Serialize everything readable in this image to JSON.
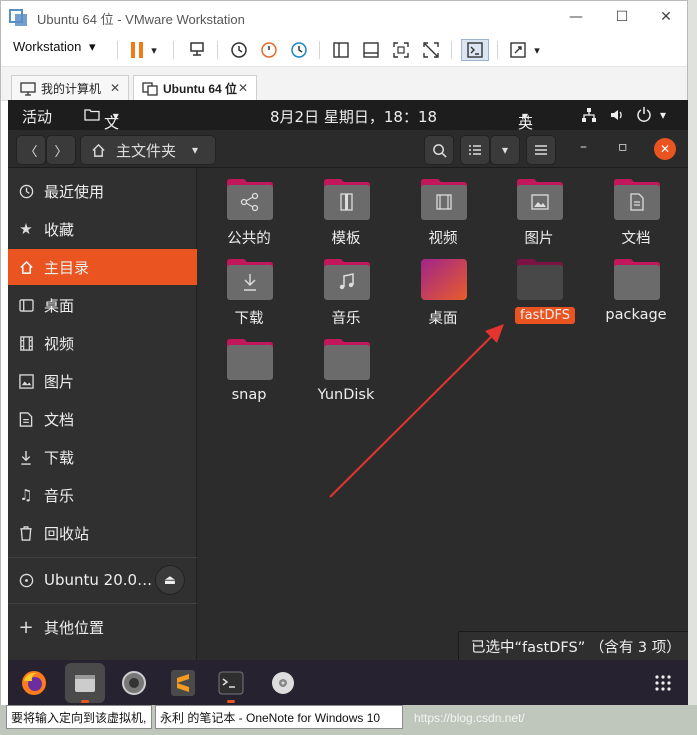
{
  "window": {
    "title": "Ubuntu 64 位 - VMware Workstation",
    "minimize": "—",
    "maximize": "☐",
    "close": "✕"
  },
  "toolbar": {
    "workstation_label": "Workstation",
    "dropdown_arrow": "▾"
  },
  "tabs": [
    {
      "label": "我的计算机",
      "close": "✕"
    },
    {
      "label": "Ubuntu 64 位",
      "close": "✕"
    }
  ],
  "ubuntu_topbar": {
    "activities": "活动",
    "app_menu": "文件",
    "app_menu_arrow": "▾",
    "clock": "8月2日 星期日，18：18",
    "input_method": "英",
    "input_arrow": "▾",
    "power_arrow": "▾"
  },
  "headerbar": {
    "back": "〈",
    "forward": "〉",
    "location": "主文件夹",
    "location_arrow": "▾",
    "view_arrow": "▾",
    "minimize": "–",
    "restore": "▫",
    "close": "✕"
  },
  "sidebar": {
    "items": [
      {
        "label": "最近使用",
        "icon": "clock-icon"
      },
      {
        "label": "收藏",
        "icon": "star-icon"
      },
      {
        "label": "主目录",
        "icon": "home-icon",
        "active": true
      },
      {
        "label": "桌面",
        "icon": "desktop-icon"
      },
      {
        "label": "视频",
        "icon": "video-icon"
      },
      {
        "label": "图片",
        "icon": "image-icon"
      },
      {
        "label": "文档",
        "icon": "document-icon"
      },
      {
        "label": "下载",
        "icon": "download-icon"
      },
      {
        "label": "音乐",
        "icon": "music-icon"
      },
      {
        "label": "回收站",
        "icon": "trash-icon"
      }
    ],
    "device": {
      "label": "Ubuntu 20.0…",
      "eject": "⏏"
    },
    "other": {
      "label": "其他位置",
      "icon_glyph": "+"
    }
  },
  "folders": [
    {
      "label": "公共的",
      "emblem": "share"
    },
    {
      "label": "模板",
      "emblem": "template"
    },
    {
      "label": "视频",
      "emblem": "video"
    },
    {
      "label": "图片",
      "emblem": "image"
    },
    {
      "label": "文档",
      "emblem": "document"
    },
    {
      "label": "下载",
      "emblem": "download"
    },
    {
      "label": "音乐",
      "emblem": "music"
    },
    {
      "label": "桌面",
      "emblem": "desktop"
    },
    {
      "label": "fastDFS",
      "emblem": "none",
      "selected": true
    },
    {
      "label": "package",
      "emblem": "none"
    },
    {
      "label": "snap",
      "emblem": "none"
    },
    {
      "label": "YunDisk",
      "emblem": "none"
    }
  ],
  "statusbar": {
    "text": "已选中“fastDFS” （含有 3 项）"
  },
  "dock": {
    "apps": [
      "firefox-icon",
      "files-icon",
      "settings-icon",
      "sublime-icon",
      "terminal-icon",
      "disc-icon"
    ],
    "grid_icon": "show-apps-icon"
  },
  "host_taskbar": {
    "task1": "要将输入定向到该虚拟机,",
    "task2": "永利 的笔记本 - OneNote for Windows 10",
    "watermark": "https://blog.csdn.net/"
  },
  "colors": {
    "accent": "#e95420",
    "folder_tab": "#c2185b",
    "folder_body": "#6b6b6b"
  }
}
